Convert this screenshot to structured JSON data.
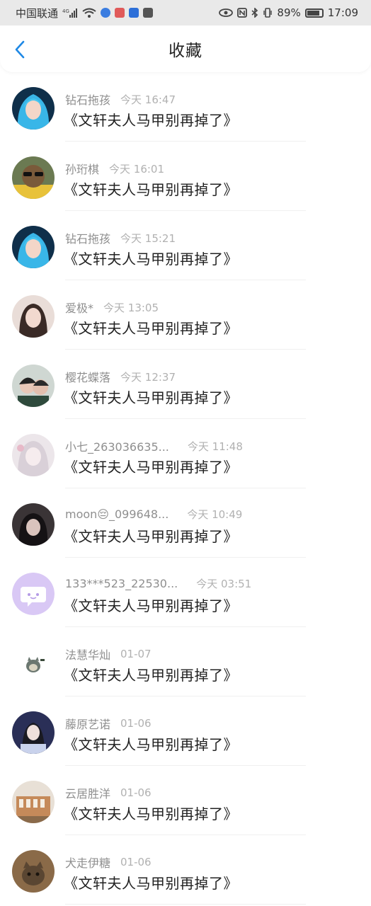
{
  "status_bar": {
    "carrier": "中国联通",
    "network": "4G",
    "battery": "89%",
    "time": "17:09"
  },
  "header": {
    "title": "收藏",
    "back_icon": "chevron-left-icon",
    "accent": "#1e88e5"
  },
  "favorites": [
    {
      "name": "钻石拖孩",
      "time": "今天 16:47",
      "message": "《文轩夫人马甲别再掉了》"
    },
    {
      "name": "孙珩棋",
      "time": "今天 16:01",
      "message": "《文轩夫人马甲别再掉了》"
    },
    {
      "name": "钻石拖孩",
      "time": "今天 15:21",
      "message": "《文轩夫人马甲别再掉了》"
    },
    {
      "name": "爱极*",
      "time": "今天 13:05",
      "message": "《文轩夫人马甲别再掉了》"
    },
    {
      "name": "樱花蝶落",
      "time": "今天 12:37",
      "message": "《文轩夫人马甲别再掉了》"
    },
    {
      "name": "小七_263036635...",
      "time": "今天 11:48",
      "message": "《文轩夫人马甲别再掉了》"
    },
    {
      "name": "moon😔_099648...",
      "time": "今天 10:49",
      "message": "《文轩夫人马甲别再掉了》"
    },
    {
      "name": "133***523_22530...",
      "time": "今天 03:51",
      "message": "《文轩夫人马甲别再掉了》"
    },
    {
      "name": "法慧华灿",
      "time": "01-07",
      "message": "《文轩夫人马甲别再掉了》"
    },
    {
      "name": "藤原艺诺",
      "time": "01-06",
      "message": "《文轩夫人马甲别再掉了》"
    },
    {
      "name": "云居胜洋",
      "time": "01-06",
      "message": "《文轩夫人马甲别再掉了》"
    },
    {
      "name": "犬走伊糖",
      "time": "01-06",
      "message": "《文轩夫人马甲别再掉了》"
    }
  ]
}
